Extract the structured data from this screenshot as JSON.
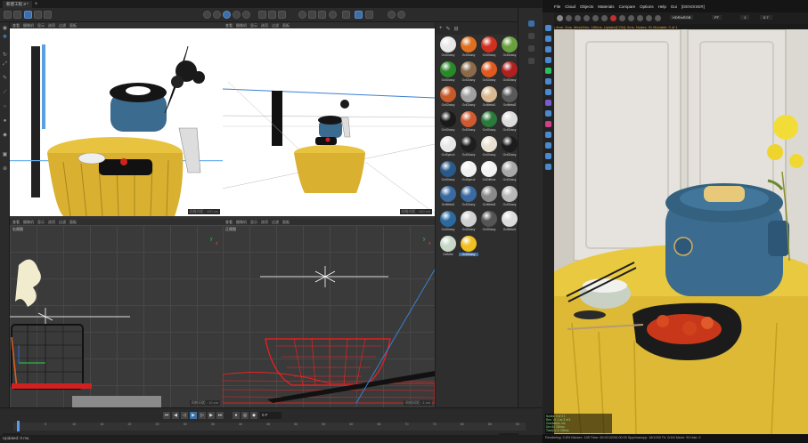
{
  "c4d": {
    "tab_title": "新建工程 3 *",
    "viewport_menus": [
      "查看",
      "摄像机",
      "显示",
      "选项",
      "过滤",
      "面板"
    ],
    "vp1_footer": "网格间距 : 100 cm",
    "vp2_footer": "网格间距 : 100 cm",
    "vp3_title": "右视图",
    "vp3_footer": "网格间距 : 10 cm",
    "vp4_title": "正视图",
    "vp4_footer": "网格间距 : 1 cm",
    "materials": [
      {
        "label": "OctGlossy",
        "color": "#e8e8e8"
      },
      {
        "label": "OctGlossy",
        "color": "#e07020"
      },
      {
        "label": "OctGlossy",
        "color": "#d03020"
      },
      {
        "label": "OctGlossy",
        "color": "#6aa040"
      },
      {
        "label": "OctGlossy",
        "color": "#2a8a2a"
      },
      {
        "label": "OctGlossy",
        "color": "#8a6a4a"
      },
      {
        "label": "OctGlossy",
        "color": "#e05a20"
      },
      {
        "label": "OctGlossy",
        "color": "#b02020"
      },
      {
        "label": "OctGlossy",
        "color": "#c85a2a"
      },
      {
        "label": "OctGlossy",
        "color": "#a0a0a0"
      },
      {
        "label": "OctMetal1",
        "color": "#d8b890"
      },
      {
        "label": "OctMetal2",
        "color": "#5a5a5a"
      },
      {
        "label": "OctGlossy",
        "color": "#1a1a1a"
      },
      {
        "label": "OctGlossy",
        "color": "#d05a30"
      },
      {
        "label": "OctGlossy",
        "color": "#2a7a3a"
      },
      {
        "label": "OctGlossy",
        "color": "#dcdcdc"
      },
      {
        "label": "OctSpecul",
        "color": "#e8e8e8"
      },
      {
        "label": "OctGlossy",
        "color": "#1e1e1e"
      },
      {
        "label": "OctGlossy",
        "color": "#e8e0d0"
      },
      {
        "label": "OctGlossy",
        "color": "#1c1c1c"
      },
      {
        "label": "OctGlossy",
        "color": "#2a5a8a"
      },
      {
        "label": "OctSpecul",
        "color": "#f0f0f0"
      },
      {
        "label": "OctDiffuse",
        "color": "#f2f2f2"
      },
      {
        "label": "OctGlossy",
        "color": "#a8a8a8"
      },
      {
        "label": "OctMetal1",
        "color": "#3a6aa0"
      },
      {
        "label": "OctGlossy",
        "color": "#3a6aa0"
      },
      {
        "label": "OctMetal3",
        "color": "#8a8a8a"
      },
      {
        "label": "OctGlossy",
        "color": "#b8b8b8"
      },
      {
        "label": "OctGlossy",
        "color": "#2a6aa0"
      },
      {
        "label": "OctGlossy",
        "color": "#d0d0d0"
      },
      {
        "label": "OctGlossy",
        "color": "#555555"
      },
      {
        "label": "OctMetal1",
        "color": "#dcdcdc"
      },
      {
        "label": "OctMixe",
        "color": "#c8d8c8"
      },
      {
        "label": "OctGlossy",
        "color": "#f0c020",
        "selected": true
      }
    ],
    "frame_value": "0 F",
    "timeline_ticks": [
      "0",
      "5",
      "10",
      "15",
      "20",
      "25",
      "30",
      "35",
      "40",
      "45",
      "50",
      "55",
      "60",
      "65",
      "70",
      "75",
      "80",
      "85",
      "90"
    ],
    "start_field": "0 F",
    "end_field": "90 F",
    "status": "Updated: 0 ms."
  },
  "octane": {
    "menu": [
      "File",
      "Cloud",
      "Objects",
      "Materials",
      "Compare",
      "Options",
      "Help",
      "Gui"
    ],
    "render_mode": "HDR/sRGB",
    "camera": "PT",
    "value_1": "1",
    "value_2": "0.7",
    "denoise": "[DENOISER]",
    "info_line": "Check time: 0ms. MeshGen: 180ms. Update[CON]: 0ms. Nodes: 91 Movable: 0 of 1",
    "log": [
      "Nodes: 9 of 3 1",
      "Ren. Vl: 1 on 3 of 3",
      "Gravitation: ms",
      "Dev 80 200ms",
      "Total(0): 2/ 200ms",
      "Reflection rays: 1 / 4"
    ],
    "status_line": "Rendering: 0.8%  Ms/sec: 195  Time: 00:00:02/00:00:00  Spp/maxspp: 18/1000  Tri: 0/1M  Mesh: 93  Hair: 0"
  },
  "colors": {
    "accent": "#3c6fa8",
    "table_cloth": "#e8c340",
    "cooker_body": "#3b6b8f",
    "orange_text": "#e0a030"
  }
}
